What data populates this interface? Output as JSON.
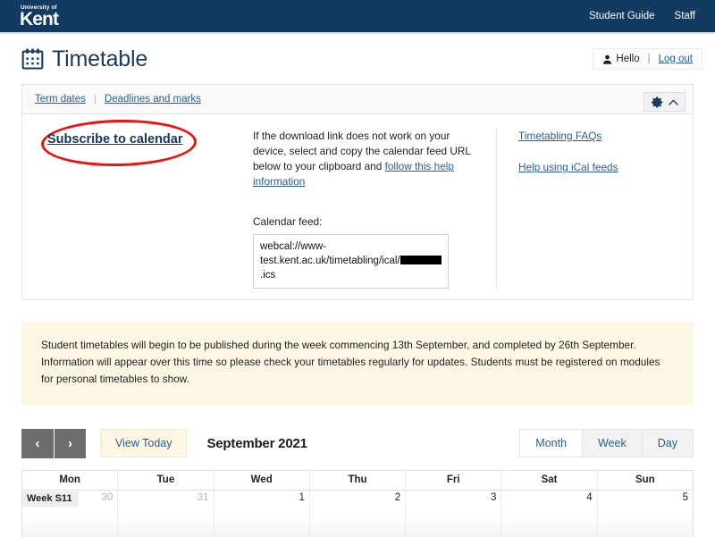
{
  "topbar": {
    "brand_small": "University of",
    "brand_main": "Kent",
    "nav": [
      {
        "label": "Student Guide"
      },
      {
        "label": "Staff"
      }
    ]
  },
  "pagehead": {
    "title": "Timetable",
    "user": {
      "hello": "Hello",
      "divider": "|",
      "logout": "Log out"
    }
  },
  "panel": {
    "tabs": [
      {
        "label": "Term dates"
      },
      {
        "label": "Deadlines and marks"
      }
    ],
    "tab_separator": "|",
    "subscribe_link": "Subscribe to calendar",
    "description": {
      "text_before_link": "If the download link does not work on your device, select and copy the calendar feed URL below to your clipboard and ",
      "link_text": "follow this help information"
    },
    "feed": {
      "label": "Calendar feed:",
      "url_part1": "webcal://www-test.kent.ac.uk/timetabling/ical/",
      "url_redacted": "",
      "url_part2": ".ics"
    },
    "help_links": [
      {
        "label": "Timetabling FAQs"
      },
      {
        "label": "Help using iCal feeds"
      }
    ]
  },
  "notice": {
    "text": "Student timetables will begin to be published during the week commencing 13th September, and completed by 26th September. Information will appear over this time so please check your timetables regularly for updates. Students must be registered on modules for personal timetables to show."
  },
  "calendar": {
    "prev_label": "‹",
    "next_label": "›",
    "today_label": "View Today",
    "title": "September 2021",
    "views": [
      {
        "label": "Month",
        "active": true
      },
      {
        "label": "Week",
        "active": false
      },
      {
        "label": "Day",
        "active": false
      }
    ],
    "day_headers": [
      "Mon",
      "Tue",
      "Wed",
      "Thu",
      "Fri",
      "Sat",
      "Sun"
    ],
    "week_badge": "Week S11",
    "days": [
      {
        "num": "30",
        "muted": true
      },
      {
        "num": "31",
        "muted": true
      },
      {
        "num": "1",
        "muted": false
      },
      {
        "num": "2",
        "muted": false
      },
      {
        "num": "3",
        "muted": false
      },
      {
        "num": "4",
        "muted": false
      },
      {
        "num": "5",
        "muted": false
      }
    ]
  },
  "colors": {
    "navy": "#103a60",
    "link": "#2a5d94",
    "notice_bg": "#fdf6e3",
    "annotation_red": "#ee1111"
  }
}
